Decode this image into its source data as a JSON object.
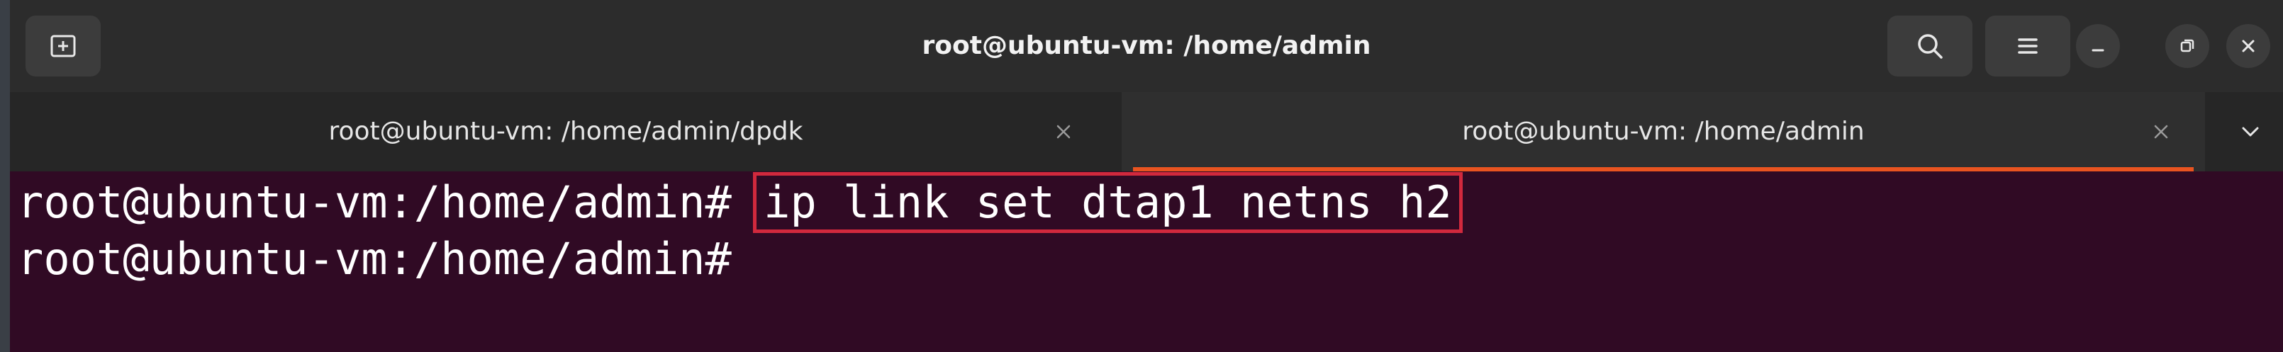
{
  "window": {
    "title": "root@ubuntu-vm: /home/admin"
  },
  "tabs": [
    {
      "label": "root@ubuntu-vm: /home/admin/dpdk",
      "active": false
    },
    {
      "label": "root@ubuntu-vm: /home/admin",
      "active": true
    }
  ],
  "terminal": {
    "lines": [
      {
        "prompt": "root@ubuntu-vm:/home/admin#",
        "command": "ip link set dtap1 netns h2"
      },
      {
        "prompt": "root@ubuntu-vm:/home/admin#",
        "command": ""
      }
    ]
  },
  "colors": {
    "terminal_bg": "#300a24",
    "accent": "#e95420",
    "highlight_box": "#d1293d",
    "headerbar_bg": "#2c2c2c"
  },
  "icons": {
    "new_tab": "new-tab-icon",
    "search": "search-icon",
    "menu": "hamburger-menu-icon",
    "minimize": "minimize-icon",
    "maximize": "restore-icon",
    "close": "close-icon",
    "tab_close": "close-icon",
    "tab_overflow": "chevron-down-icon"
  }
}
